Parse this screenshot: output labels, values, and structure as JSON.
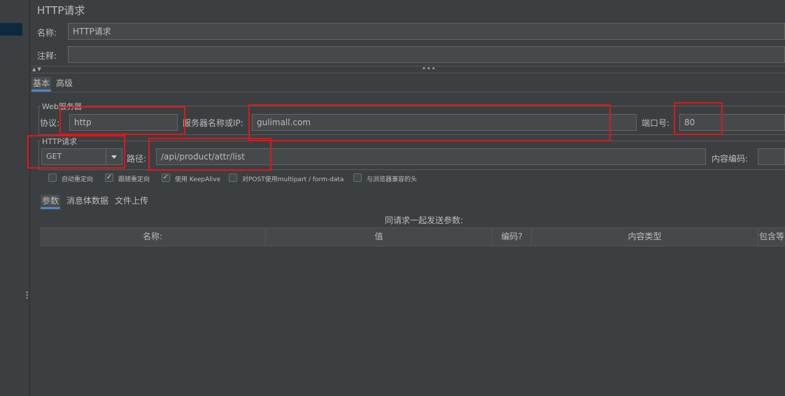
{
  "title": "HTTP请求",
  "name": {
    "label": "名称:",
    "value": "HTTP请求"
  },
  "comment": {
    "label": "注释:",
    "value": ""
  },
  "tabs": {
    "basic": "基本",
    "advanced": "高级"
  },
  "web_server": {
    "group_title": "Web服务器",
    "protocol_label": "协议:",
    "protocol_value": "http",
    "server_label": "服务器名称或IP:",
    "server_value": "gulimall.com",
    "port_label": "端口号:",
    "port_value": "80"
  },
  "http_request": {
    "group_title": "HTTP请求",
    "method_value": "GET",
    "path_label": "路径:",
    "path_value": "/api/product/attr/list",
    "encoding_label": "内容编码:",
    "encoding_value": ""
  },
  "options": [
    {
      "label": "自动重定向",
      "checked": false
    },
    {
      "label": "跟随重定向",
      "checked": true
    },
    {
      "label": "使用 KeepAlive",
      "checked": true
    },
    {
      "label": "对POST使用multipart / form-data",
      "checked": false
    },
    {
      "label": "与浏览器兼容的头",
      "checked": false
    }
  ],
  "subtabs": {
    "params": "参数",
    "body": "消息体数据",
    "files": "文件上传"
  },
  "params_table": {
    "caption": "同请求一起发送参数:",
    "columns": [
      "名称:",
      "值",
      "编码?",
      "内容类型",
      "包含等"
    ]
  },
  "colors": {
    "accent": "#4a88c7",
    "highlight": "#e0161b",
    "background": "#3c3f41"
  }
}
